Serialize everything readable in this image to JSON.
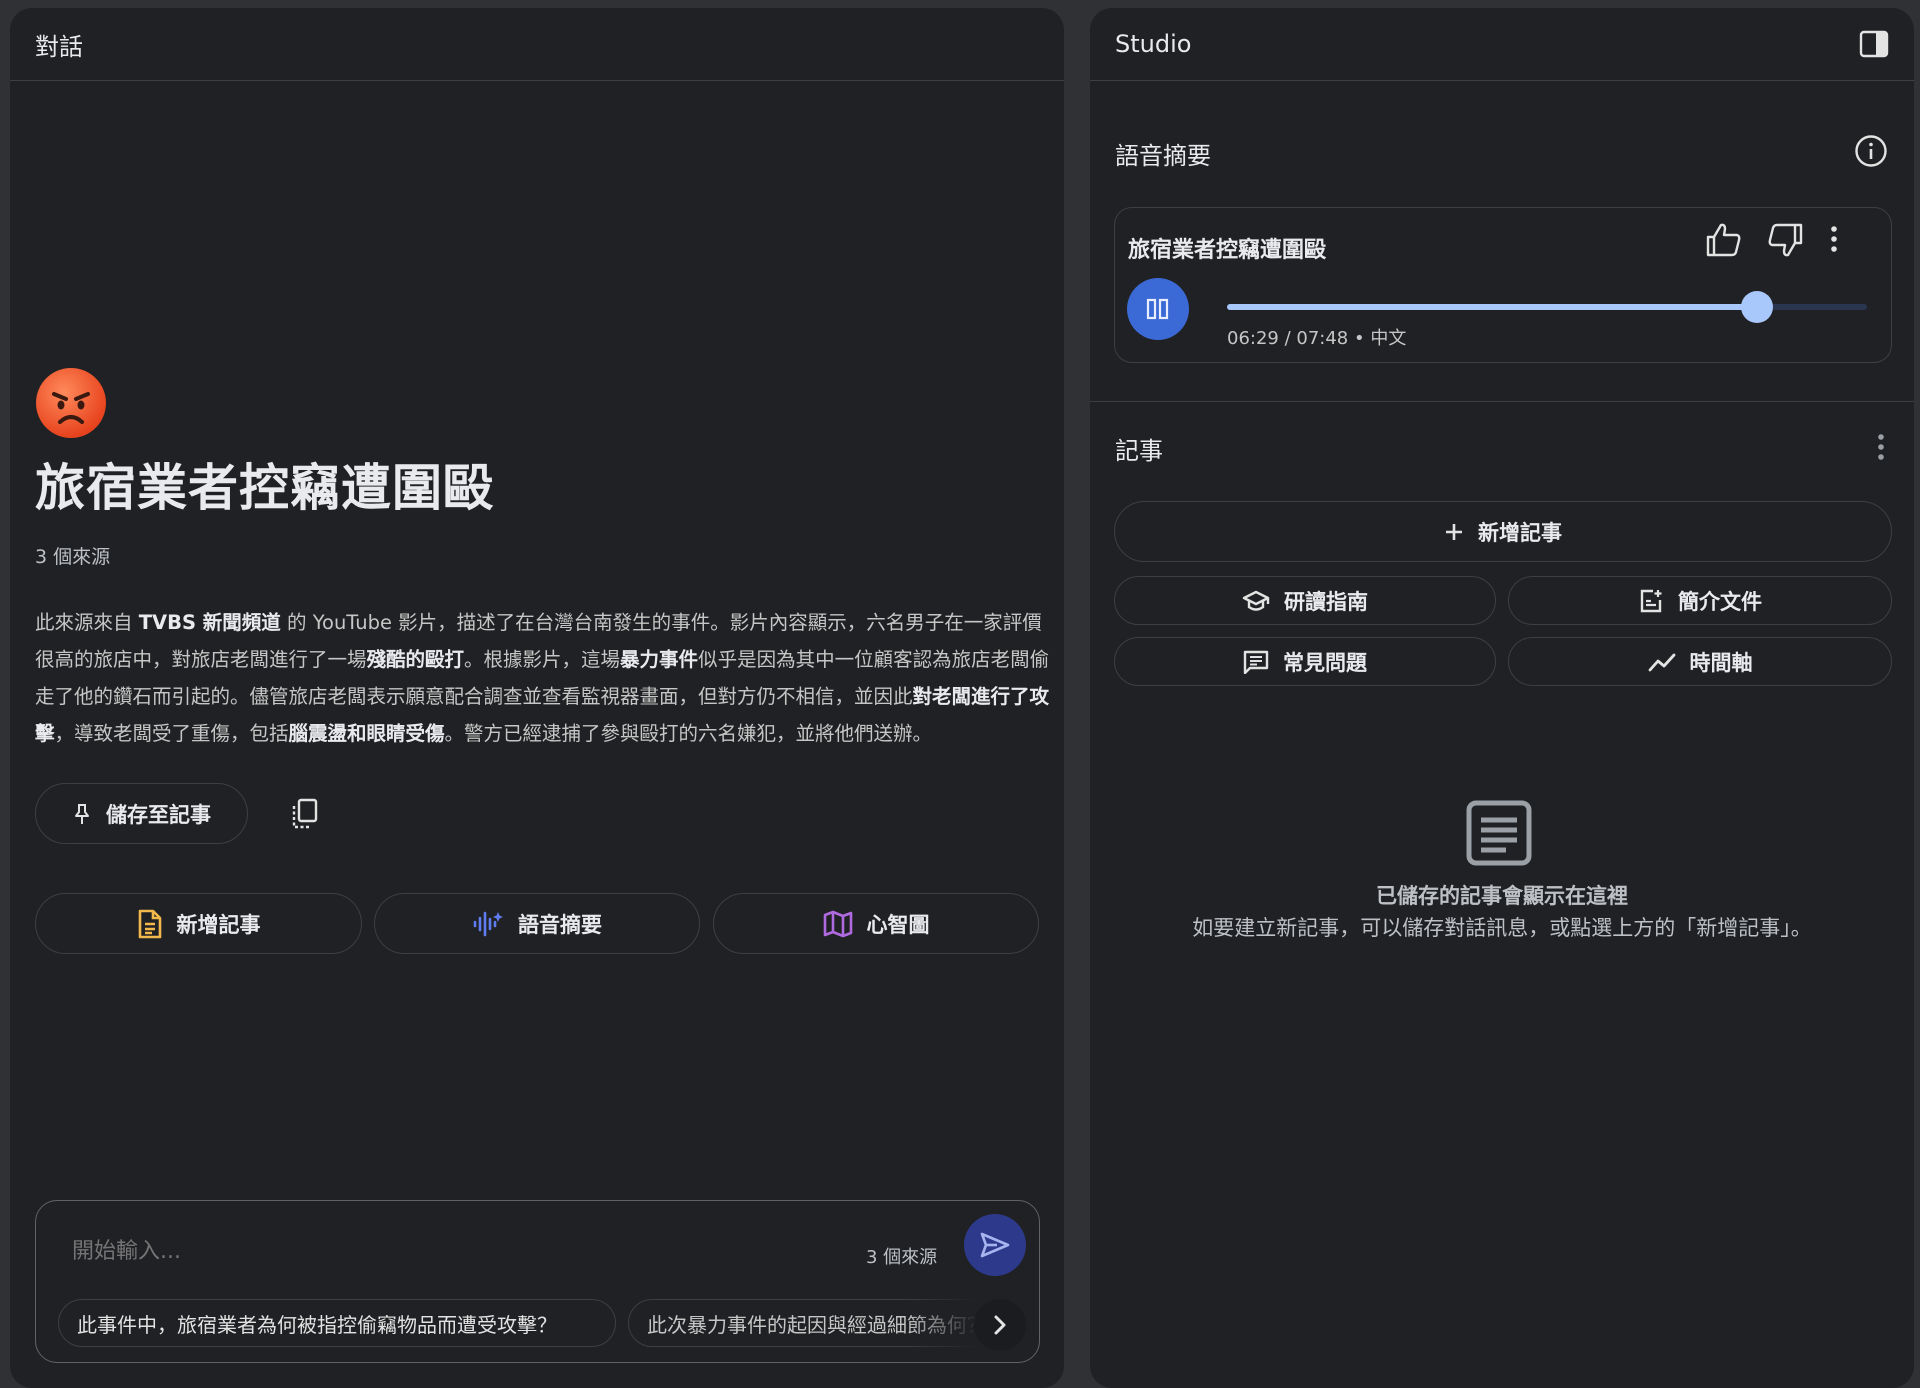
{
  "left_panel": {
    "title": "對話",
    "notebook": {
      "emoji": "angry-face",
      "title": "旅宿業者控竊遭圍毆",
      "source_count": "3 個來源",
      "summary_parts": [
        {
          "text": "此來源來自 ",
          "bold": false
        },
        {
          "text": "TVBS 新聞頻道",
          "bold": true
        },
        {
          "text": " 的 YouTube 影片，描述了在台灣台南發生的事件。影片內容顯示，六名男子在一家評價很高的旅店中，對旅店老闆進行了一場",
          "bold": false
        },
        {
          "text": "殘酷的毆打",
          "bold": true
        },
        {
          "text": "。根據影片，這場",
          "bold": false
        },
        {
          "text": "暴力事件",
          "bold": true
        },
        {
          "text": "似乎是因為其中一位顧客認為旅店老闆偷走了他的鑽石而引起的。儘管旅店老闆表示願意配合調查並查看監視器畫面，但對方仍不相信，並因此",
          "bold": false
        },
        {
          "text": "對老闆進行了攻擊",
          "bold": true
        },
        {
          "text": "，導致老闆受了重傷，包括",
          "bold": false
        },
        {
          "text": "腦震盪和眼睛受傷",
          "bold": true
        },
        {
          "text": "。警方已經逮捕了參與毆打的六名嫌犯，並將他們送辦。",
          "bold": false
        }
      ]
    },
    "save_to_notes_label": "儲存至記事",
    "quick_actions": [
      {
        "label": "新增記事",
        "icon": "note-icon",
        "color": "#f2b84b"
      },
      {
        "label": "語音摘要",
        "icon": "audio-wave-icon",
        "color": "#5f7cf0"
      },
      {
        "label": "心智圖",
        "icon": "map-icon",
        "color": "#b06ae0"
      }
    ],
    "chat": {
      "placeholder": "開始輸入...",
      "source_count": "3 個來源",
      "suggestions": [
        "此事件中，旅宿業者為何被指控偷竊物品而遭受攻擊？",
        "此次暴力事件的起因與經過細節為何？"
      ]
    }
  },
  "right_panel": {
    "title": "Studio",
    "audio_overview": {
      "section_title": "語音摘要",
      "card_title": "旅宿業者控竊遭圍毆",
      "time_text": "06:29 / 07:48 • 中文",
      "progress": 0.828,
      "accent": "#a8c7fa"
    },
    "notes": {
      "section_title": "記事",
      "add_note_label": "新增記事",
      "grid": [
        {
          "label": "研讀指南",
          "icon": "graduation-cap-icon"
        },
        {
          "label": "簡介文件",
          "icon": "document-icon"
        },
        {
          "label": "常見問題",
          "icon": "faq-icon"
        },
        {
          "label": "時間軸",
          "icon": "timeline-icon"
        }
      ],
      "empty_title": "已儲存的記事會顯示在這裡",
      "empty_subtitle": "如要建立新記事，可以儲存對話訊息，或點選上方的「新增記事」。"
    }
  }
}
